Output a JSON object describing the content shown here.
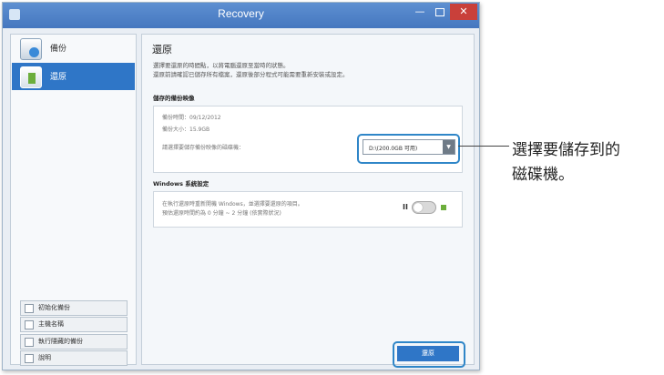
{
  "window": {
    "title": "Recovery",
    "min_glyph": "—",
    "close_glyph": "✕"
  },
  "sidebar": {
    "items": [
      {
        "label": "備份"
      },
      {
        "label": "還原"
      }
    ],
    "buttons": [
      {
        "label": "初始化備份"
      },
      {
        "label": "主機名稱"
      },
      {
        "label": "執行隱藏的備份"
      },
      {
        "label": "說明"
      }
    ]
  },
  "main": {
    "title": "還原",
    "description_lines": [
      "選擇要還原的時間點，以將電腦還原至當時的狀態。",
      "還原前請確認已儲存所有檔案，還原後部分程式可能需要重新安裝或設定。"
    ],
    "storage_section": {
      "heading": "儲存的備份映像",
      "backup_date": "備份時間：09/12/2012",
      "backup_size": "備份大小：15.9GB",
      "select_prompt": "請選擇要儲存備份映像的磁碟機：",
      "drive_value": "D:\\(200.0GB 可用)",
      "drive_arrow": "▼"
    },
    "windows_section": {
      "heading": "Windows 系統設定",
      "line1": "在執行還原時重新開機 Windows，並選擇要還原的項目。",
      "line2": "預估還原時間約為 0 分鐘 ~ 2 分鐘 (依實際狀況)",
      "pause_glyph": "II",
      "toggle_on": false
    },
    "restore_button": "還原"
  },
  "callout": {
    "line1": "選擇要儲存到的",
    "line2": "磁碟機。"
  },
  "colors": {
    "accent": "#2f76c7",
    "highlight": "#2f86c8",
    "titlebar": "#4f83c8",
    "close": "#c9403a"
  }
}
